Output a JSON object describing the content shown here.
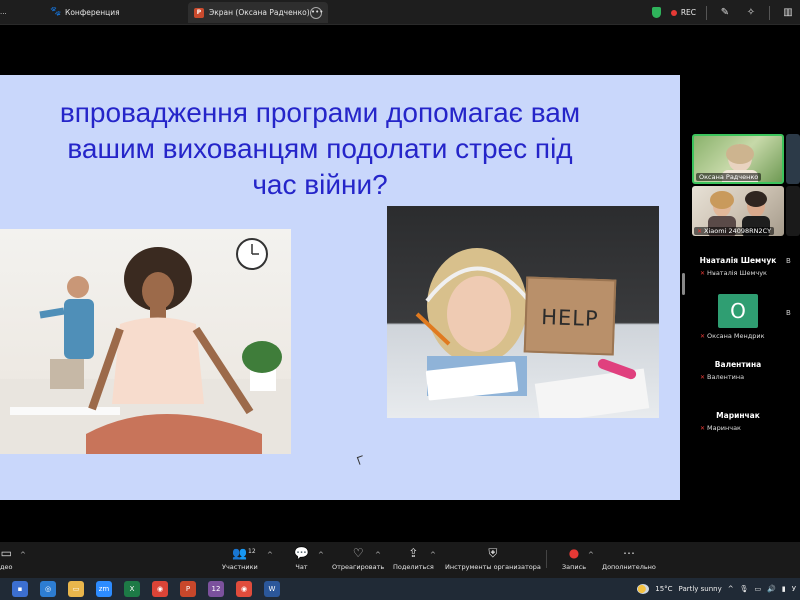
{
  "topbar": {
    "tab_conference": "Конференция",
    "tab_screen": "Экран (Оксана Радченко)",
    "rec_label": "REC",
    "icons": [
      "paw-icon",
      "powerpoint-icon",
      "more-icon",
      "shield-icon",
      "pen-icon",
      "magic-icon",
      "layout-icon"
    ]
  },
  "slide": {
    "title_line1": "впровадження програми допомагає вам",
    "title_line2": "вашим вихованцям подолати стрес під",
    "title_line3": "час війни?",
    "help_sign": "HELP",
    "title_color": "#2525c9",
    "background": "#c9d7fb"
  },
  "participants": {
    "tile1_name": "Оксана Радченко",
    "tile2_name": "Xiaomi 24098RN2CY",
    "p1_name": "Нᴚаталія Шемчук",
    "p1_sub": "Нᴚаталія Шемчук",
    "p2_avatar": "O",
    "p2_sub": "Оксана Мендрик",
    "p3_name": "Валентина",
    "p3_sub": "Валентина",
    "p4_name": "Маринчак",
    "p4_sub": "Маринчак",
    "edge_letters": [
      "В",
      "В"
    ]
  },
  "toolbar": {
    "video_label": "део",
    "participants_label": "Участники",
    "participants_count": "12",
    "chat_label": "Чат",
    "react_label": "Отреагировать",
    "share_label": "Поделиться",
    "host_tools_label": "Инструменты организатора",
    "record_label": "Запись",
    "more_label": "Дополнительно"
  },
  "taskbar": {
    "weather_temp": "15°C",
    "weather_desc": "Partly sunny",
    "viber_badge": "12",
    "lang_hint": "У"
  }
}
